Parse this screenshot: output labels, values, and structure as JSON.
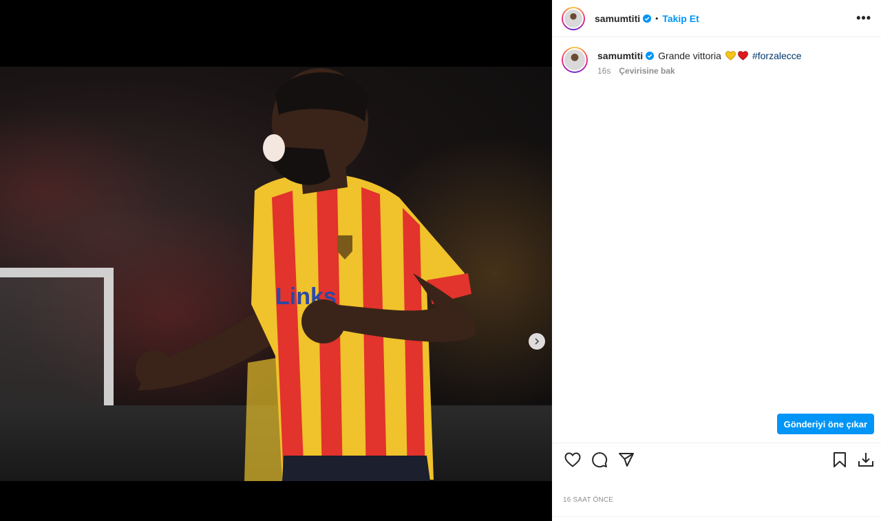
{
  "post": {
    "username": "samumtiti",
    "follow_label": "Takip Et",
    "separator": "•",
    "more_label": "•••",
    "caption_text": "Grande vittoria",
    "hashtag": "#forzalecce",
    "relative_time": "16s",
    "translate_label": "Çevirisine bak",
    "boost_label": "Gönderiyi öne çıkar",
    "timestamp": "16 SAAT ÖNCE"
  },
  "media": {
    "carousel_count": 2,
    "carousel_active_index": 0
  },
  "icons": {
    "verified": "verified-badge-icon",
    "like": "heart-outline-icon",
    "comment": "comment-bubble-icon",
    "share": "paper-plane-icon",
    "save": "bookmark-icon",
    "download": "download-icon",
    "next": "chevron-right-icon"
  },
  "colors": {
    "accent": "#0095f6",
    "hashtag": "#00376b",
    "muted": "#8e8e8e",
    "emoji_yellow": "#f5c518",
    "emoji_red": "#e0191d"
  }
}
